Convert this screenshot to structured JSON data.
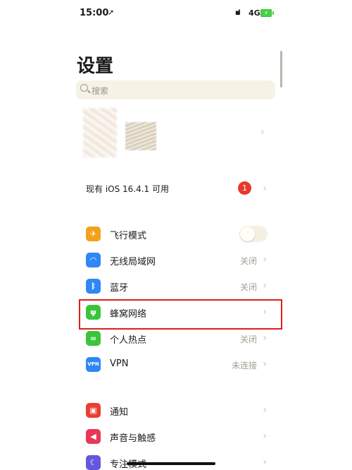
{
  "status": {
    "time": "15:00",
    "location_glyph": "➚",
    "signal": "ıııl",
    "network": "4G",
    "battery": "⚡"
  },
  "header": {
    "title": "设置"
  },
  "search": {
    "placeholder": "搜索"
  },
  "update": {
    "label": "现有 iOS 16.4.1 可用",
    "badge": "1"
  },
  "connectivity": [
    {
      "label": "飞行模式",
      "icon": "airplane-icon",
      "color": "#f2a21a",
      "glyph": "✈"
    },
    {
      "label": "无线局域网",
      "value": "关闭",
      "icon": "wifi-icon",
      "color": "#2f86f6",
      "glyph": "◠"
    },
    {
      "label": "蓝牙",
      "value": "关闭",
      "icon": "bluetooth-icon",
      "color": "#2f86f6",
      "glyph": "ᛒ"
    },
    {
      "label": "蜂窝网络",
      "icon": "cellular-icon",
      "color": "#3bc43b",
      "glyph": "ψ"
    },
    {
      "label": "个人热点",
      "value": "关闭",
      "icon": "hotspot-icon",
      "color": "#3bc43b",
      "glyph": "∞"
    },
    {
      "label": "VPN",
      "value": "未连接",
      "icon": "vpn-icon",
      "color": "#2f86f6",
      "glyph": "VPN"
    }
  ],
  "system": [
    {
      "label": "通知",
      "icon": "notification-icon",
      "color": "#ea3e31",
      "glyph": "▣"
    },
    {
      "label": "声音与触感",
      "icon": "sound-icon",
      "color": "#ea3757",
      "glyph": "◀"
    },
    {
      "label": "专注模式",
      "icon": "focus-icon",
      "color": "#6457dc",
      "glyph": "☾"
    }
  ],
  "chevron": "›"
}
